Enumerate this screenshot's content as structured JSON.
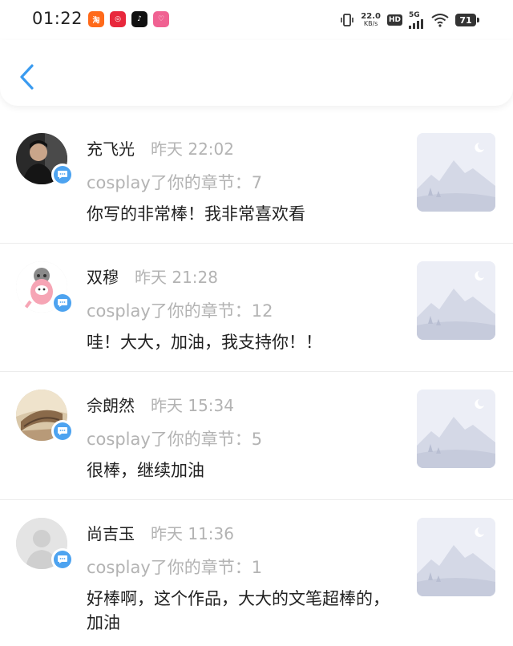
{
  "status_bar": {
    "time": "01:22",
    "net_speed_value": "22.0",
    "net_speed_unit": "KB/s",
    "hd_label": "HD",
    "signal_label": "5G",
    "battery_level": "71",
    "app_icons": [
      "taobao-app-icon",
      "app-icon-red",
      "tiktok-app-icon",
      "app-icon-pink"
    ]
  },
  "header": {
    "back_icon": "chevron-left-icon",
    "accent_color": "#3a9bf0"
  },
  "comments": [
    {
      "username": "充飞光",
      "time": "昨天 22:02",
      "chapter": "cosplay了你的章节：7",
      "text": "你写的非常棒！我非常喜欢看"
    },
    {
      "username": "双穆",
      "time": "昨天 21:28",
      "chapter": "cosplay了你的章节：12",
      "text": "哇！大大，加油，我支持你！！"
    },
    {
      "username": "佘朗然",
      "time": "昨天 15:34",
      "chapter": "cosplay了你的章节：5",
      "text": "很棒，继续加油"
    },
    {
      "username": "尚吉玉",
      "time": "昨天 11:36",
      "chapter": "cosplay了你的章节：1",
      "text": "好棒啊，这个作品，大大的文笔超棒的，加油"
    }
  ],
  "colors": {
    "badge_blue": "#4da3f0",
    "muted_text": "#b3b3b3"
  }
}
